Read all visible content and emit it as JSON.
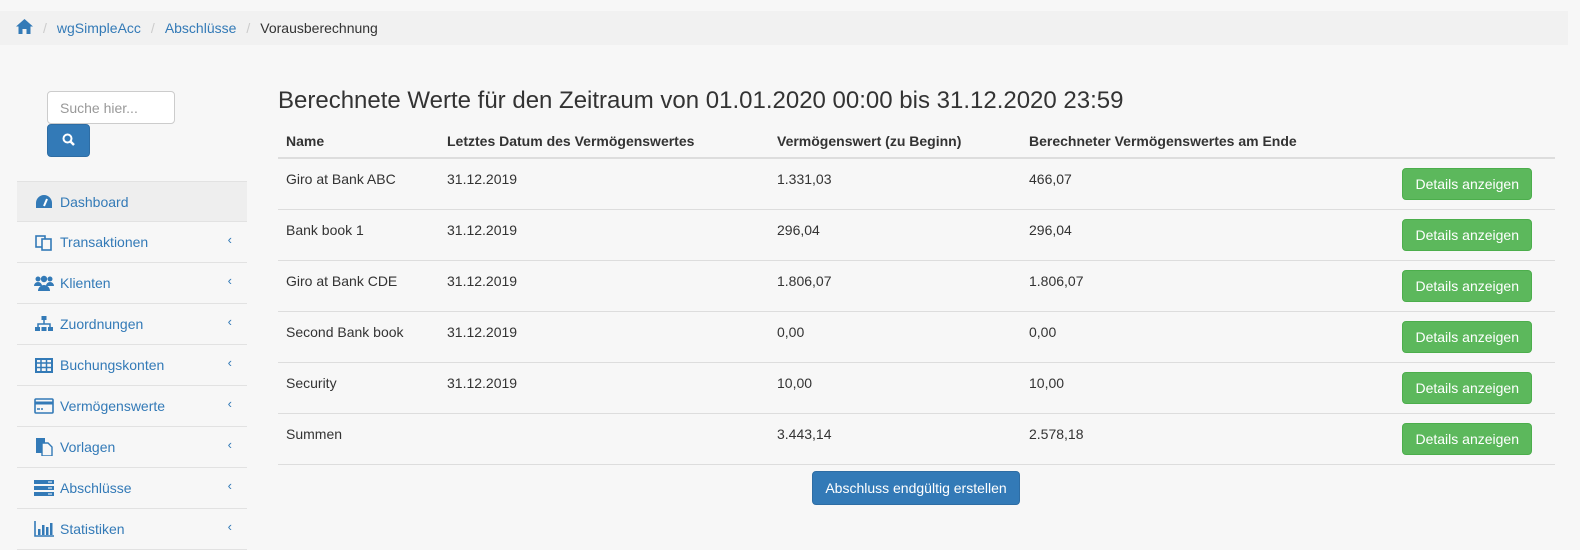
{
  "breadcrumb": {
    "items": [
      "wgSimpleAcc",
      "Abschlüsse"
    ],
    "current": "Vorausberechnung"
  },
  "sidebar": {
    "search_placeholder": "Suche hier...",
    "items": [
      {
        "label": "Dashboard",
        "icon": "dashboard-icon"
      },
      {
        "label": "Transaktionen",
        "icon": "copy-icon"
      },
      {
        "label": "Klienten",
        "icon": "users-icon"
      },
      {
        "label": "Zuordnungen",
        "icon": "sitemap-icon"
      },
      {
        "label": "Buchungskonten",
        "icon": "table-icon"
      },
      {
        "label": "Vermögenswerte",
        "icon": "credit-card-icon"
      },
      {
        "label": "Vorlagen",
        "icon": "file-icon"
      },
      {
        "label": "Abschlüsse",
        "icon": "server-icon"
      },
      {
        "label": "Statistiken",
        "icon": "bar-chart-icon"
      }
    ]
  },
  "main": {
    "title": "Berechnete Werte für den Zeitraum von 01.01.2020 00:00 bis 31.12.2020 23:59",
    "columns": [
      "Name",
      "Letztes Datum des Vermögenswertes",
      "Vermögenswert (zu Beginn)",
      "Berechneter Vermögenswertes am Ende"
    ],
    "rows": [
      [
        "Giro at Bank ABC",
        "31.12.2019",
        "1.331,03",
        "466,07"
      ],
      [
        "Bank book 1",
        "31.12.2019",
        "296,04",
        "296,04"
      ],
      [
        "Giro at Bank CDE",
        "31.12.2019",
        "1.806,07",
        "1.806,07"
      ],
      [
        "Second Bank book",
        "31.12.2019",
        "0,00",
        "0,00"
      ],
      [
        "Security",
        "31.12.2019",
        "10,00",
        "10,00"
      ],
      [
        "Summen",
        "",
        "3.443,14",
        "2.578,18"
      ]
    ],
    "details_label": "Details anzeigen",
    "submit_label": "Abschluss endgültig erstellen"
  }
}
